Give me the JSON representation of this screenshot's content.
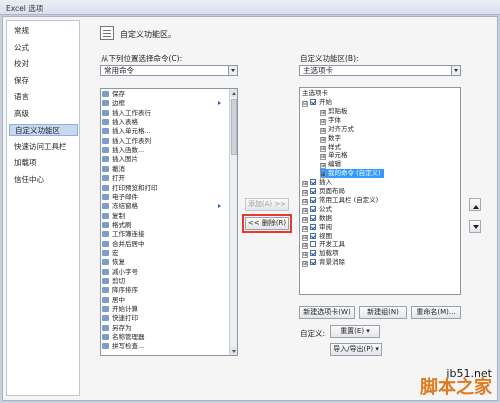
{
  "window": {
    "title": "Excel 选项"
  },
  "nav": {
    "items": [
      "常规",
      "公式",
      "校对",
      "保存",
      "语言",
      "高级",
      "自定义功能区",
      "快速访问工具栏",
      "加载项",
      "信任中心"
    ],
    "selected_index": 6
  },
  "main": {
    "title": "自定义功能区。"
  },
  "left_pane": {
    "label": "从下列位置选择命令(C):",
    "combo_value": "常用命令",
    "commands": [
      "保存",
      "边框",
      "插入工作表行",
      "插入表格",
      "插入单元格...",
      "插入工作表列",
      "插入函数...",
      "插入图片",
      "撤消",
      "打开",
      "打印预览和打印",
      "电子邮件",
      "冻结窗格",
      "复制",
      "格式刷",
      "工作簿连接",
      "合并后居中",
      "宏",
      "恢复",
      "减小字号",
      "剪切",
      "降序排序",
      "居中",
      "开始计算",
      "快速打印",
      "另存为",
      "名称管理器",
      "拼写检查..."
    ],
    "submenu_indices": [
      1,
      12
    ]
  },
  "middle": {
    "add_label": "添加(A) >>",
    "remove_label": "<< 删除(R)"
  },
  "right_pane": {
    "label": "自定义功能区(B):",
    "combo_value": "主选项卡",
    "tree_header": "主选项卡",
    "tree": [
      {
        "level": 0,
        "toggle": "⊟",
        "checked": true,
        "label": "开始"
      },
      {
        "level": 1,
        "toggle": "⊞",
        "checked": null,
        "label": "剪贴板"
      },
      {
        "level": 1,
        "toggle": "⊞",
        "checked": null,
        "label": "字体"
      },
      {
        "level": 1,
        "toggle": "⊞",
        "checked": null,
        "label": "对齐方式"
      },
      {
        "level": 1,
        "toggle": "⊞",
        "checked": null,
        "label": "数字"
      },
      {
        "level": 1,
        "toggle": "⊞",
        "checked": null,
        "label": "样式"
      },
      {
        "level": 1,
        "toggle": "⊞",
        "checked": null,
        "label": "单元格"
      },
      {
        "level": 1,
        "toggle": "⊞",
        "checked": null,
        "label": "编辑"
      },
      {
        "level": 1,
        "toggle": "⊞",
        "checked": null,
        "label": "我的命令 (自定义)",
        "selected": true
      },
      {
        "level": 0,
        "toggle": "⊞",
        "checked": true,
        "label": "插入"
      },
      {
        "level": 0,
        "toggle": "⊞",
        "checked": true,
        "label": "页面布局"
      },
      {
        "level": 0,
        "toggle": "⊞",
        "checked": true,
        "label": "常用工具栏 (自定义)"
      },
      {
        "level": 0,
        "toggle": "⊞",
        "checked": true,
        "label": "公式"
      },
      {
        "level": 0,
        "toggle": "⊞",
        "checked": true,
        "label": "数据"
      },
      {
        "level": 0,
        "toggle": "⊞",
        "checked": true,
        "label": "审阅"
      },
      {
        "level": 0,
        "toggle": "⊞",
        "checked": true,
        "label": "视图"
      },
      {
        "level": 0,
        "toggle": "⊞",
        "checked": false,
        "label": "开发工具"
      },
      {
        "level": 0,
        "toggle": "⊞",
        "checked": true,
        "label": "加载项"
      },
      {
        "level": 0,
        "toggle": "⊞",
        "checked": true,
        "label": "背景消除"
      }
    ],
    "new_tab_label": "新建选项卡(W)",
    "new_group_label": "新建组(N)",
    "rename_label": "重命名(M)...",
    "customize_label": "自定义:",
    "reset_label": "重置(E) ▾",
    "import_export_label": "导入/导出(P) ▾"
  },
  "watermark": {
    "url": "jb51.net",
    "name": "脚本之家"
  },
  "colors": {
    "selected_bg": "#3399ff",
    "nav_selected": "#c7d9f1",
    "highlight_border": "#e23a2c",
    "watermark_orange": "#e07a1f"
  }
}
